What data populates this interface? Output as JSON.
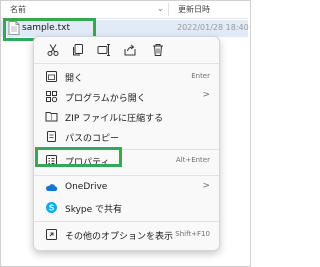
{
  "header": {
    "name_col": "名前",
    "date_col": "更新日時"
  },
  "file": {
    "name": "sample.txt",
    "modified": "2022/01/28 18:40"
  },
  "quick_actions": [
    {
      "icon": "cut-icon"
    },
    {
      "icon": "copy-icon"
    },
    {
      "icon": "rename-icon"
    },
    {
      "icon": "share-icon"
    },
    {
      "icon": "delete-icon"
    }
  ],
  "menu": {
    "open": {
      "label": "開く",
      "shortcut": "Enter"
    },
    "open_with": {
      "label": "プログラムから開く",
      "arrow": ">"
    },
    "zip": {
      "label": "ZIP ファイルに圧縮する"
    },
    "copy_path": {
      "label": "パスのコピー"
    },
    "properties": {
      "label": "プロパティ",
      "shortcut": "Alt+Enter"
    },
    "onedrive": {
      "label": "OneDrive",
      "arrow": ">"
    },
    "skype": {
      "label": "Skype で共有"
    },
    "more_options": {
      "label": "その他のオプションを表示",
      "shortcut": "Shift+F10"
    }
  },
  "colors": {
    "highlight": "#34a853",
    "selection": "#e1ebf7",
    "onedrive": "#0f78d4",
    "skype": "#00aff0"
  }
}
